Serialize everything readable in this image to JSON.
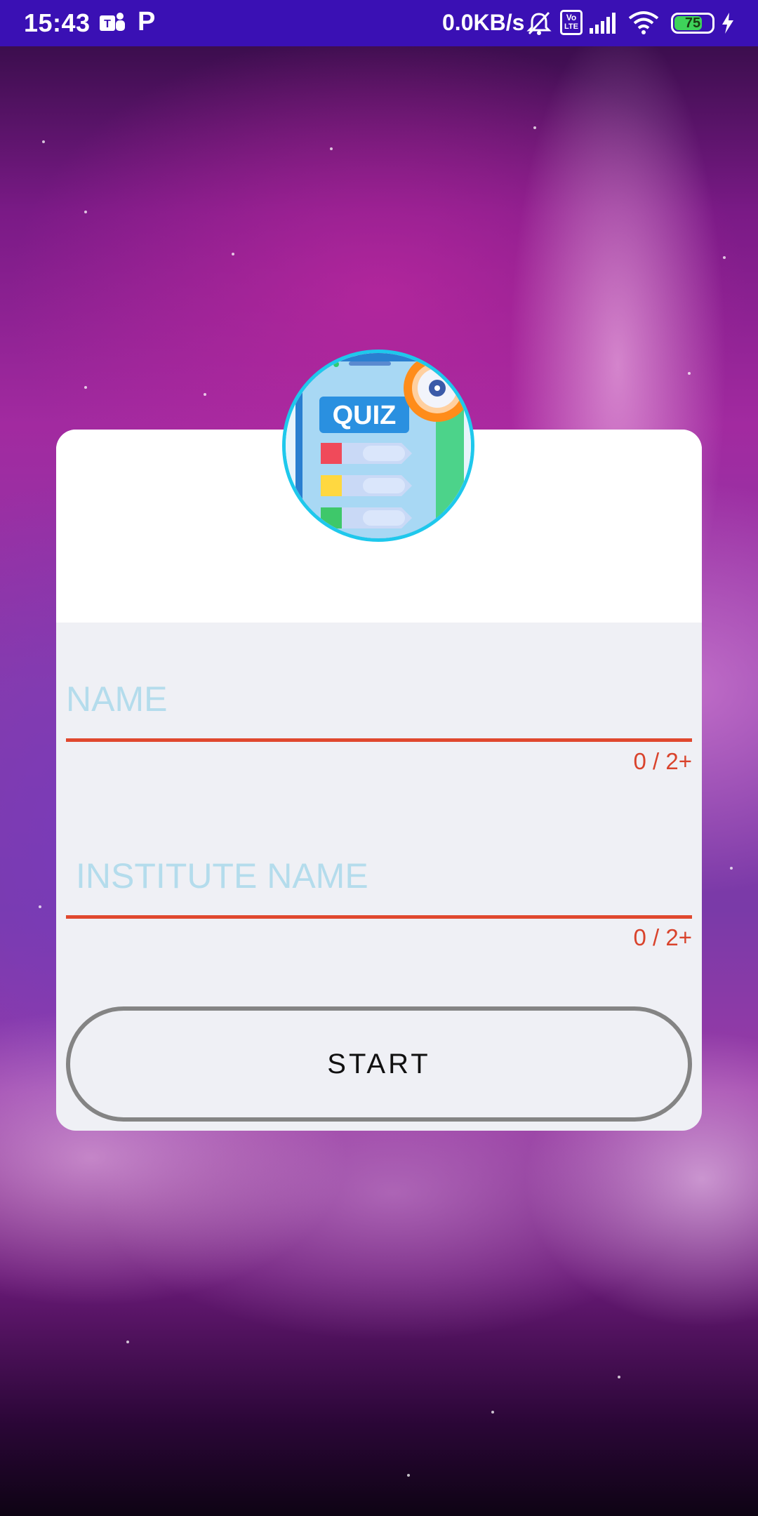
{
  "status_bar": {
    "time": "15:43",
    "notification_app": "P",
    "network_speed": "0.0KB/s",
    "volte_label_top": "Vo",
    "volte_label_bottom": "LTE",
    "battery_level": "75",
    "battery_fraction": 0.75,
    "icons": [
      "teams-icon",
      "mute-icon",
      "volte-icon",
      "signal-icon",
      "wifi-icon",
      "battery-icon",
      "charging-icon"
    ]
  },
  "logo": {
    "title": "QUIZ",
    "icon": "quiz-app-logo"
  },
  "form": {
    "name": {
      "placeholder": "NAME",
      "value": "",
      "counter": "0 / 2+"
    },
    "institute": {
      "placeholder": "INSTITUTE NAME",
      "value": "",
      "counter": "0 / 2+"
    },
    "start_label": "START"
  },
  "colors": {
    "status_bar": "#3a10b4",
    "accent_underline": "#e0482e",
    "placeholder": "#b4dcec",
    "logo_ring": "#1ec8ec",
    "card_body": "#eff0f5",
    "button_border": "#848484"
  }
}
